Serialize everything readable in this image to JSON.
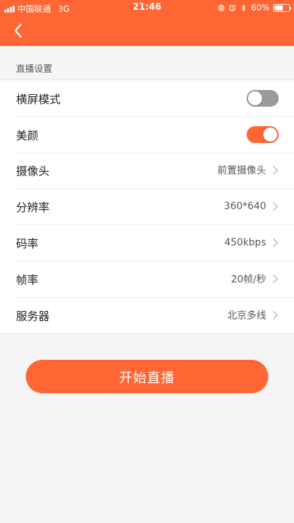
{
  "status_bar": {
    "carrier": "中国联通",
    "network": "3G",
    "time": "21:46",
    "battery": "60%",
    "battery_level": 0.6
  },
  "nav": {
    "back_icon": "chevron-left-icon"
  },
  "section": {
    "title": "直播设置"
  },
  "settings": {
    "landscape": {
      "label": "横屏模式",
      "on": false
    },
    "beauty": {
      "label": "美颜",
      "on": true
    },
    "camera": {
      "label": "摄像头",
      "value": "前置摄像头"
    },
    "resolution": {
      "label": "分辨率",
      "value": "360*640"
    },
    "bitrate": {
      "label": "码率",
      "value": "450kbps"
    },
    "framerate": {
      "label": "帧率",
      "value": "20帧/秒"
    },
    "server": {
      "label": "服务器",
      "value": "北京多线"
    }
  },
  "actions": {
    "start_label": "开始直播"
  },
  "colors": {
    "accent": "#ff6633",
    "toggle_off": "#9a9a9a",
    "background": "#f5f5f5"
  }
}
